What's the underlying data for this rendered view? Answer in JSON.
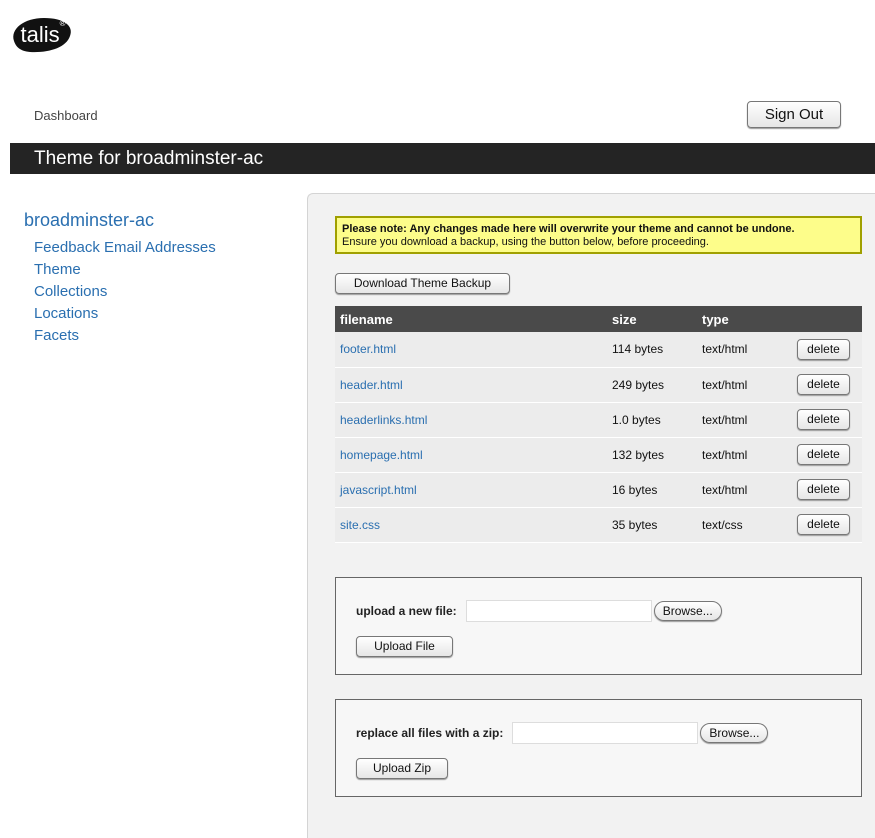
{
  "logo": {
    "text": "talis",
    "mark": "®"
  },
  "header": {
    "dashboard": "Dashboard",
    "sign_out": "Sign Out"
  },
  "page": {
    "title": "Theme for broadminster-ac"
  },
  "sidebar": {
    "site": "broadminster-ac",
    "items": [
      {
        "label": "Feedback Email Addresses"
      },
      {
        "label": "Theme"
      },
      {
        "label": "Collections"
      },
      {
        "label": "Locations"
      },
      {
        "label": "Facets"
      }
    ]
  },
  "notice": {
    "bold": "Please note: Any changes made here will overwrite your theme and cannot be undone.",
    "text": "Ensure you download a backup, using the button below, before proceeding."
  },
  "download_button": "Download Theme Backup",
  "table": {
    "headers": {
      "filename": "filename",
      "size": "size",
      "type": "type"
    },
    "rows": [
      {
        "filename": "footer.html",
        "size": "114 bytes",
        "type": "text/html",
        "action": "delete"
      },
      {
        "filename": "header.html",
        "size": "249 bytes",
        "type": "text/html",
        "action": "delete"
      },
      {
        "filename": "headerlinks.html",
        "size": "1.0 bytes",
        "type": "text/html",
        "action": "delete"
      },
      {
        "filename": "homepage.html",
        "size": "132 bytes",
        "type": "text/html",
        "action": "delete"
      },
      {
        "filename": "javascript.html",
        "size": "16 bytes",
        "type": "text/html",
        "action": "delete"
      },
      {
        "filename": "site.css",
        "size": "35 bytes",
        "type": "text/css",
        "action": "delete"
      }
    ]
  },
  "upload_file": {
    "label": "upload a new file:",
    "browse": "Browse...",
    "submit": "Upload File"
  },
  "upload_zip": {
    "label": "replace all files with a zip:",
    "browse": "Browse...",
    "submit": "Upload Zip"
  }
}
